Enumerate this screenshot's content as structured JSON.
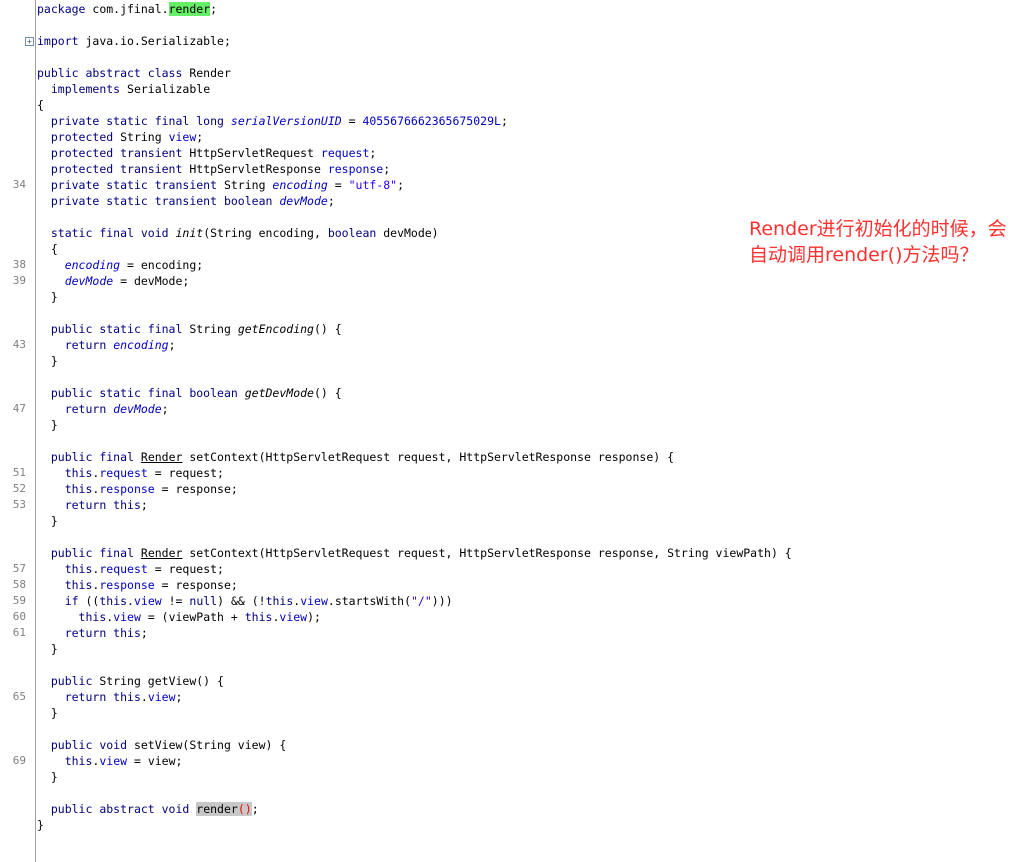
{
  "annotation": {
    "line1": "Render进行初始化的时候，会",
    "line2": "自动调用render()方法吗？"
  },
  "lines": [
    {
      "n": "",
      "t": [
        {
          "s": "package",
          "c": "kw"
        },
        {
          "s": " com.jfinal."
        },
        {
          "s": "render",
          "c": "hl-green"
        },
        {
          "s": ";"
        }
      ]
    },
    {
      "n": "",
      "t": []
    },
    {
      "n": "",
      "fold": "+",
      "t": [
        {
          "s": "import",
          "c": "kw"
        },
        {
          "s": " java.io.Serializable;"
        }
      ]
    },
    {
      "n": "",
      "t": []
    },
    {
      "n": "",
      "t": [
        {
          "s": "public abstract class",
          "c": "kw"
        },
        {
          "s": " Render"
        }
      ]
    },
    {
      "n": "",
      "t": [
        {
          "s": "  "
        },
        {
          "s": "implements",
          "c": "kw"
        },
        {
          "s": " Serializable"
        }
      ]
    },
    {
      "n": "",
      "t": [
        {
          "s": "{"
        }
      ]
    },
    {
      "n": "",
      "t": [
        {
          "s": "  "
        },
        {
          "s": "private static final long",
          "c": "kw"
        },
        {
          "s": " "
        },
        {
          "s": "serialVersionUID",
          "c": "sfld"
        },
        {
          "s": " = "
        },
        {
          "s": "4055676662365675029L",
          "c": "num"
        },
        {
          "s": ";"
        }
      ]
    },
    {
      "n": "",
      "t": [
        {
          "s": "  "
        },
        {
          "s": "protected",
          "c": "kw"
        },
        {
          "s": " String "
        },
        {
          "s": "view",
          "c": "fld"
        },
        {
          "s": ";"
        }
      ]
    },
    {
      "n": "",
      "t": [
        {
          "s": "  "
        },
        {
          "s": "protected transient",
          "c": "kw"
        },
        {
          "s": " HttpServletRequest "
        },
        {
          "s": "request",
          "c": "fld"
        },
        {
          "s": ";"
        }
      ]
    },
    {
      "n": "",
      "t": [
        {
          "s": "  "
        },
        {
          "s": "protected transient",
          "c": "kw"
        },
        {
          "s": " HttpServletResponse "
        },
        {
          "s": "response",
          "c": "fld"
        },
        {
          "s": ";"
        }
      ]
    },
    {
      "n": "34",
      "t": [
        {
          "s": "  "
        },
        {
          "s": "private static transient",
          "c": "kw"
        },
        {
          "s": " String "
        },
        {
          "s": "encoding",
          "c": "sfld"
        },
        {
          "s": " = "
        },
        {
          "s": "\"utf-8\"",
          "c": "str"
        },
        {
          "s": ";"
        }
      ]
    },
    {
      "n": "",
      "t": [
        {
          "s": "  "
        },
        {
          "s": "private static transient boolean",
          "c": "kw"
        },
        {
          "s": " "
        },
        {
          "s": "devMode",
          "c": "sfld"
        },
        {
          "s": ";"
        }
      ]
    },
    {
      "n": "",
      "t": []
    },
    {
      "n": "",
      "t": [
        {
          "s": "  "
        },
        {
          "s": "static final void",
          "c": "kw"
        },
        {
          "s": " "
        },
        {
          "s": "init",
          "c": "mth"
        },
        {
          "s": "(String encoding, "
        },
        {
          "s": "boolean",
          "c": "kw"
        },
        {
          "s": " devMode)"
        }
      ]
    },
    {
      "n": "",
      "t": [
        {
          "s": "  {"
        }
      ]
    },
    {
      "n": "38",
      "t": [
        {
          "s": "    "
        },
        {
          "s": "encoding",
          "c": "sfld"
        },
        {
          "s": " = encoding;"
        }
      ]
    },
    {
      "n": "39",
      "t": [
        {
          "s": "    "
        },
        {
          "s": "devMode",
          "c": "sfld"
        },
        {
          "s": " = devMode;"
        }
      ]
    },
    {
      "n": "",
      "t": [
        {
          "s": "  }"
        }
      ]
    },
    {
      "n": "",
      "t": []
    },
    {
      "n": "",
      "t": [
        {
          "s": "  "
        },
        {
          "s": "public static final",
          "c": "kw"
        },
        {
          "s": " String "
        },
        {
          "s": "getEncoding",
          "c": "mth"
        },
        {
          "s": "() {"
        }
      ]
    },
    {
      "n": "43",
      "t": [
        {
          "s": "    "
        },
        {
          "s": "return",
          "c": "kw"
        },
        {
          "s": " "
        },
        {
          "s": "encoding",
          "c": "sfld"
        },
        {
          "s": ";"
        }
      ]
    },
    {
      "n": "",
      "t": [
        {
          "s": "  }"
        }
      ]
    },
    {
      "n": "",
      "t": []
    },
    {
      "n": "",
      "t": [
        {
          "s": "  "
        },
        {
          "s": "public static final boolean",
          "c": "kw"
        },
        {
          "s": " "
        },
        {
          "s": "getDevMode",
          "c": "mth"
        },
        {
          "s": "() {"
        }
      ]
    },
    {
      "n": "47",
      "t": [
        {
          "s": "    "
        },
        {
          "s": "return",
          "c": "kw"
        },
        {
          "s": " "
        },
        {
          "s": "devMode",
          "c": "sfld"
        },
        {
          "s": ";"
        }
      ]
    },
    {
      "n": "",
      "t": [
        {
          "s": "  }"
        }
      ]
    },
    {
      "n": "",
      "t": []
    },
    {
      "n": "",
      "t": [
        {
          "s": "  "
        },
        {
          "s": "public final",
          "c": "kw"
        },
        {
          "s": " "
        },
        {
          "s": "Render",
          "c": "typ"
        },
        {
          "s": " setContext(HttpServletRequest request, HttpServletResponse response) {"
        }
      ]
    },
    {
      "n": "51",
      "t": [
        {
          "s": "    "
        },
        {
          "s": "this",
          "c": "kw"
        },
        {
          "s": "."
        },
        {
          "s": "request",
          "c": "fld"
        },
        {
          "s": " = request;"
        }
      ]
    },
    {
      "n": "52",
      "t": [
        {
          "s": "    "
        },
        {
          "s": "this",
          "c": "kw"
        },
        {
          "s": "."
        },
        {
          "s": "response",
          "c": "fld"
        },
        {
          "s": " = response;"
        }
      ]
    },
    {
      "n": "53",
      "t": [
        {
          "s": "    "
        },
        {
          "s": "return this",
          "c": "kw"
        },
        {
          "s": ";"
        }
      ]
    },
    {
      "n": "",
      "t": [
        {
          "s": "  }"
        }
      ]
    },
    {
      "n": "",
      "t": []
    },
    {
      "n": "",
      "t": [
        {
          "s": "  "
        },
        {
          "s": "public final",
          "c": "kw"
        },
        {
          "s": " "
        },
        {
          "s": "Render",
          "c": "typ"
        },
        {
          "s": " setContext(HttpServletRequest request, HttpServletResponse response, String viewPath) {"
        }
      ]
    },
    {
      "n": "57",
      "t": [
        {
          "s": "    "
        },
        {
          "s": "this",
          "c": "kw"
        },
        {
          "s": "."
        },
        {
          "s": "request",
          "c": "fld"
        },
        {
          "s": " = request;"
        }
      ]
    },
    {
      "n": "58",
      "t": [
        {
          "s": "    "
        },
        {
          "s": "this",
          "c": "kw"
        },
        {
          "s": "."
        },
        {
          "s": "response",
          "c": "fld"
        },
        {
          "s": " = response;"
        }
      ]
    },
    {
      "n": "59",
      "t": [
        {
          "s": "    "
        },
        {
          "s": "if",
          "c": "kw"
        },
        {
          "s": " (("
        },
        {
          "s": "this",
          "c": "kw"
        },
        {
          "s": "."
        },
        {
          "s": "view",
          "c": "fld"
        },
        {
          "s": " != "
        },
        {
          "s": "null",
          "c": "kw"
        },
        {
          "s": ") && (!"
        },
        {
          "s": "this",
          "c": "kw"
        },
        {
          "s": "."
        },
        {
          "s": "view",
          "c": "fld"
        },
        {
          "s": ".startsWith("
        },
        {
          "s": "\"/\"",
          "c": "str"
        },
        {
          "s": ")))"
        }
      ]
    },
    {
      "n": "60",
      "t": [
        {
          "s": "      "
        },
        {
          "s": "this",
          "c": "kw"
        },
        {
          "s": "."
        },
        {
          "s": "view",
          "c": "fld"
        },
        {
          "s": " = (viewPath + "
        },
        {
          "s": "this",
          "c": "kw"
        },
        {
          "s": "."
        },
        {
          "s": "view",
          "c": "fld"
        },
        {
          "s": ");"
        }
      ]
    },
    {
      "n": "61",
      "t": [
        {
          "s": "    "
        },
        {
          "s": "return this",
          "c": "kw"
        },
        {
          "s": ";"
        }
      ]
    },
    {
      "n": "",
      "t": [
        {
          "s": "  }"
        }
      ]
    },
    {
      "n": "",
      "t": []
    },
    {
      "n": "",
      "t": [
        {
          "s": "  "
        },
        {
          "s": "public",
          "c": "kw"
        },
        {
          "s": " String getView() {"
        }
      ]
    },
    {
      "n": "65",
      "t": [
        {
          "s": "    "
        },
        {
          "s": "return this",
          "c": "kw"
        },
        {
          "s": "."
        },
        {
          "s": "view",
          "c": "fld"
        },
        {
          "s": ";"
        }
      ]
    },
    {
      "n": "",
      "t": [
        {
          "s": "  }"
        }
      ]
    },
    {
      "n": "",
      "t": []
    },
    {
      "n": "",
      "t": [
        {
          "s": "  "
        },
        {
          "s": "public void",
          "c": "kw"
        },
        {
          "s": " setView(String view) {"
        }
      ]
    },
    {
      "n": "69",
      "t": [
        {
          "s": "    "
        },
        {
          "s": "this",
          "c": "kw"
        },
        {
          "s": "."
        },
        {
          "s": "view",
          "c": "fld"
        },
        {
          "s": " = view;"
        }
      ]
    },
    {
      "n": "",
      "t": [
        {
          "s": "  }"
        }
      ]
    },
    {
      "n": "",
      "t": []
    },
    {
      "n": "",
      "t": [
        {
          "s": "  "
        },
        {
          "s": "public abstract void",
          "c": "kw"
        },
        {
          "s": " "
        },
        {
          "s": "render",
          "c": "hl-gray"
        },
        {
          "s": "()",
          "c": "paren-red"
        },
        {
          "s": ";"
        }
      ]
    },
    {
      "n": "",
      "t": [
        {
          "s": "}"
        }
      ]
    }
  ]
}
